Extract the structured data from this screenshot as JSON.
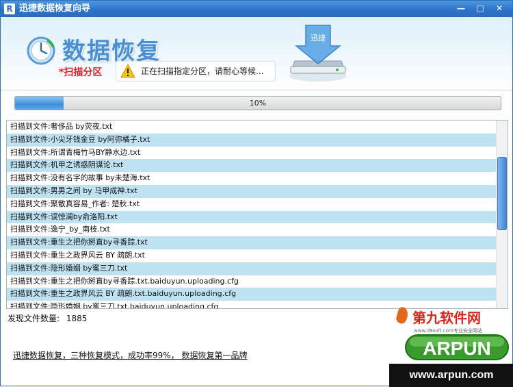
{
  "window": {
    "title": "迅捷数据恢复向导",
    "app_icon": "R",
    "controls": {
      "minimize": "—",
      "maximize": "□",
      "close": "✕"
    }
  },
  "header": {
    "title": "数据恢复",
    "step": "*扫描分区",
    "status_message": "正在扫描指定分区，请耐心等候...",
    "drive_badge": "迅捷",
    "icons": [
      "clock-icon",
      "warning-icon",
      "hard-drive-icon"
    ]
  },
  "progress": {
    "percent": 10,
    "label": "10%"
  },
  "scan_list": {
    "rows": [
      "扫描到文件:奢侈品 by荧夜.txt",
      "扫描到文件:小尖牙钱金豆 by阿弥橘子.txt",
      "扫描到文件:所谓青梅竹马BY静水边.txt",
      "扫描到文件:机甲之诱惑阴谋论.txt",
      "扫描到文件:没有名字的故事 by未楚海.txt",
      "扫描到文件:男男之间 by 马甲成神.txt",
      "扫描到文件:聚散真容易_作者: 楚秋.txt",
      "扫描到文件:误惊澜by俞洛阳.txt",
      "扫描到文件:逸宁_by_南枝.txt",
      "扫描到文件:重生之把你掰直by寻香踪.txt",
      "扫描到文件:重生之政界风云 BY  疏朗.txt",
      "扫描到文件:隐形婚姻 by蜜三刀.txt",
      "扫描到文件:重生之把你掰直by寻香踪.txt.baiduyun.uploading.cfg",
      "扫描到文件:重生之政界风云 BY  疏朗.txt.baiduyun.uploading.cfg",
      "扫描到文件:隐形婚姻 by蜜三刀.txt.baiduyun.uploading.cfg"
    ],
    "scroll_position": 0.32,
    "scroll_visible_fraction": 0.39
  },
  "footer": {
    "found_label": "发现文件数量:",
    "found_count": "1885",
    "promo_text": "迅捷数据恢复，三种恢复模式，成功率99%， 数据恢复第一品牌"
  },
  "watermark": {
    "brand_cn": "第九软件网",
    "tagline": "www.d9soft.com专业安全网站",
    "brand_en": "ARPUN",
    "url": "www.arpun.com"
  },
  "colors": {
    "titlebar": "#2d74c9",
    "header_title": "#4a8fd1",
    "step_label": "#e0202c",
    "row_alt": "#bfe2f2",
    "progress_fill": "#3f8fd9",
    "logo_green": "#3a9b2c",
    "logo_red": "#d9261c"
  }
}
